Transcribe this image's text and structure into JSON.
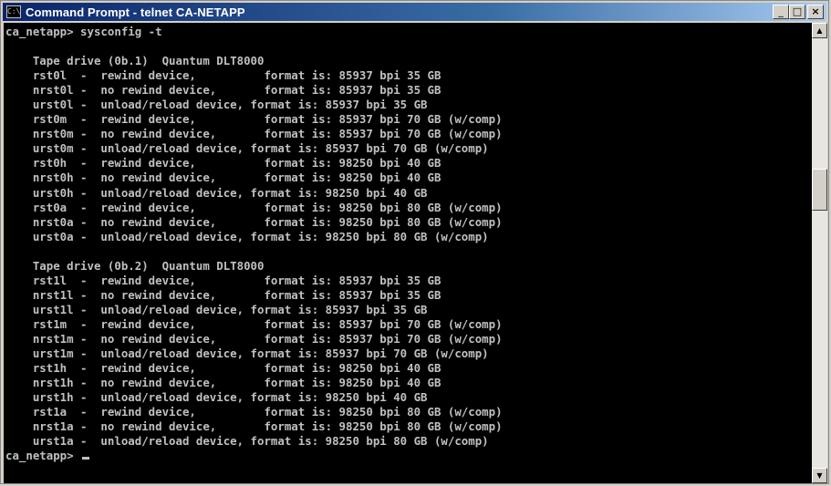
{
  "window": {
    "title": "Command Prompt - telnet CA-NETAPP",
    "buttons": {
      "minimize": "_",
      "maximize": "□",
      "close": "×"
    },
    "icon": "console-app-icon"
  },
  "console": {
    "lines": [
      "ca_netapp> sysconfig -t",
      "",
      "    Tape drive (0b.1)  Quantum DLT8000",
      "    rst0l  -  rewind device,          format is: 85937 bpi 35 GB",
      "    nrst0l -  no rewind device,       format is: 85937 bpi 35 GB",
      "    urst0l -  unload/reload device, format is: 85937 bpi 35 GB",
      "    rst0m  -  rewind device,          format is: 85937 bpi 70 GB (w/comp)",
      "    nrst0m -  no rewind device,       format is: 85937 bpi 70 GB (w/comp)",
      "    urst0m -  unload/reload device, format is: 85937 bpi 70 GB (w/comp)",
      "    rst0h  -  rewind device,          format is: 98250 bpi 40 GB",
      "    nrst0h -  no rewind device,       format is: 98250 bpi 40 GB",
      "    urst0h -  unload/reload device, format is: 98250 bpi 40 GB",
      "    rst0a  -  rewind device,          format is: 98250 bpi 80 GB (w/comp)",
      "    nrst0a -  no rewind device,       format is: 98250 bpi 80 GB (w/comp)",
      "    urst0a -  unload/reload device, format is: 98250 bpi 80 GB (w/comp)",
      "",
      "    Tape drive (0b.2)  Quantum DLT8000",
      "    rst1l  -  rewind device,          format is: 85937 bpi 35 GB",
      "    nrst1l -  no rewind device,       format is: 85937 bpi 35 GB",
      "    urst1l -  unload/reload device, format is: 85937 bpi 35 GB",
      "    rst1m  -  rewind device,          format is: 85937 bpi 70 GB (w/comp)",
      "    nrst1m -  no rewind device,       format is: 85937 bpi 70 GB (w/comp)",
      "    urst1m -  unload/reload device, format is: 85937 bpi 70 GB (w/comp)",
      "    rst1h  -  rewind device,          format is: 98250 bpi 40 GB",
      "    nrst1h -  no rewind device,       format is: 98250 bpi 40 GB",
      "    urst1h -  unload/reload device, format is: 98250 bpi 40 GB",
      "    rst1a  -  rewind device,          format is: 98250 bpi 80 GB (w/comp)",
      "    nrst1a -  no rewind device,       format is: 98250 bpi 80 GB (w/comp)",
      "    urst1a -  unload/reload device, format is: 98250 bpi 80 GB (w/comp)"
    ],
    "prompt": "ca_netapp> "
  },
  "scrollbar": {
    "up_icon": "▲",
    "down_icon": "▼"
  },
  "colors": {
    "title_gradient_start": "#0a246a",
    "title_gradient_end": "#a6caf0",
    "console_bg": "#000000",
    "console_fg": "#c0c0c0",
    "chrome": "#d4d0c8"
  }
}
